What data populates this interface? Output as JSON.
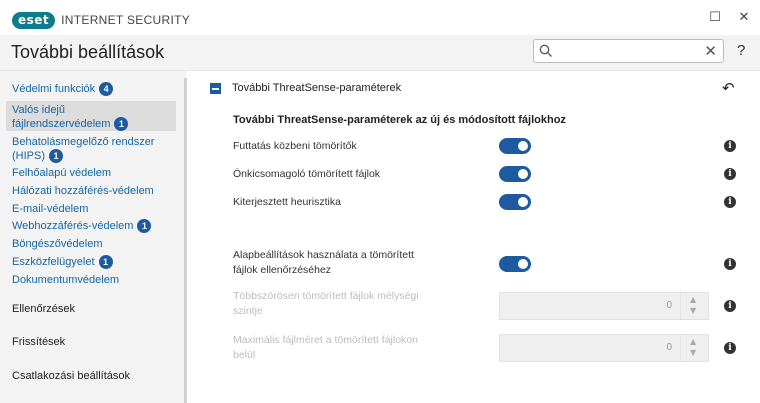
{
  "app": {
    "logo_text": "eset",
    "product_name": "INTERNET SECURITY"
  },
  "header": {
    "title": "További beállítások",
    "search_placeholder": "",
    "clear_glyph": "✕",
    "help_glyph": "?"
  },
  "window": {
    "maximize_glyph": "☐",
    "close_glyph": "✕"
  },
  "sidebar": {
    "items": [
      {
        "label": "Védelmi funkciók",
        "badge": "4"
      },
      {
        "label": "Valós idejű",
        "label2": "fájlrendszervédelem",
        "badge": "1"
      },
      {
        "label": "Behatolásmegelőző rendszer",
        "label2": "(HIPS)",
        "badge": "1"
      },
      {
        "label": "Felhőalapú védelem"
      },
      {
        "label": "Hálózati hozzáférés-védelem"
      },
      {
        "label": "E-mail-védelem"
      },
      {
        "label": "Webhozzáférés-védelem",
        "badge": "1"
      },
      {
        "label": "Böngészővédelem"
      },
      {
        "label": "Eszközfelügyelet",
        "badge": "1"
      },
      {
        "label": "Dokumentumvédelem"
      },
      {
        "label": "Ellenőrzések"
      },
      {
        "label": "Frissítések"
      },
      {
        "label": "Csatlakozási beállítások"
      }
    ]
  },
  "main": {
    "section_title": "További ThreatSense-paraméterek",
    "undo_glyph": "↶",
    "subheading": "További ThreatSense-paraméterek az új és módosított fájlokhoz",
    "rows": [
      {
        "label": "Futtatás közbeni tömörítők",
        "enabled": true
      },
      {
        "label": "Önkicsomagoló tömörített fájlok",
        "enabled": true
      },
      {
        "label": "Kiterjesztett heurisztika",
        "enabled": true
      },
      {
        "label": "Alapbeállítások használata a tömörített",
        "label2": "fájlok ellenőrzéséhez",
        "enabled": true
      }
    ],
    "steppers": [
      {
        "label": "Többszörösen tömörített fájlok mélységi",
        "label2": "szintje",
        "value": "0"
      },
      {
        "label": "Maximális fájlméret a tömörített fájlokon",
        "label2": "belül",
        "value": "0"
      }
    ],
    "info_glyph": "i",
    "up_glyph": "▲",
    "down_glyph": "▼"
  },
  "colors": {
    "accent": "#1e5aa0",
    "link": "#1565a6",
    "brand": "#0e7d8a"
  }
}
